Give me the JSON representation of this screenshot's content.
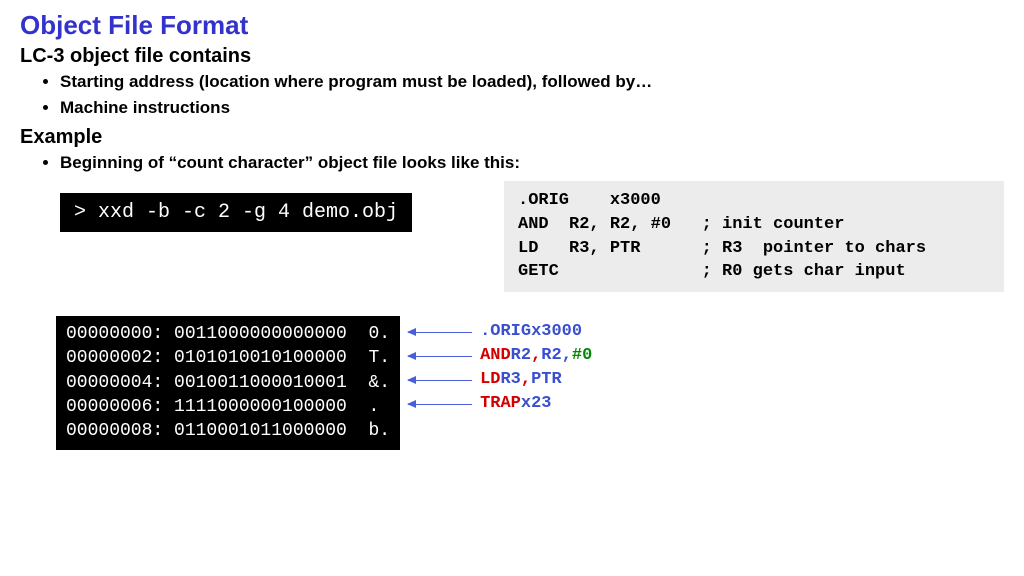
{
  "title": "Object File Format",
  "sub1": "LC-3 object file contains",
  "bullets1": {
    "a": "Starting address (location where program must be loaded), followed by…",
    "b": "Machine instructions"
  },
  "sub2": "Example",
  "bullets2": {
    "a": "Beginning of “count character” object file looks like this:"
  },
  "cmd": "> xxd -b -c 2 -g 4 demo.obj",
  "asm": ".ORIG    x3000\nAND  R2, R2, #0   ; init counter\nLD   R3, PTR      ; R3  pointer to chars\nGETC              ; R0 gets char input",
  "hex": "00000000: 0011000000000000  0.\n00000002: 0101010010100000  T.\n00000004: 0010011000010001  &.\n00000006: 1111000000100000  .\n00000008: 0110001011000000  b.",
  "annot": {
    "r1": {
      "a": ".ORIG ",
      "b": "x3000"
    },
    "r2": {
      "a": "AND ",
      "b": "R2",
      "c": ", ",
      "d": "R2",
      "e": ", ",
      "f": "#0"
    },
    "r3": {
      "a": "LD ",
      "b": "R3",
      "c": ", ",
      "d": "PTR"
    },
    "r4": {
      "a": "TRAP ",
      "b": "x23"
    }
  }
}
